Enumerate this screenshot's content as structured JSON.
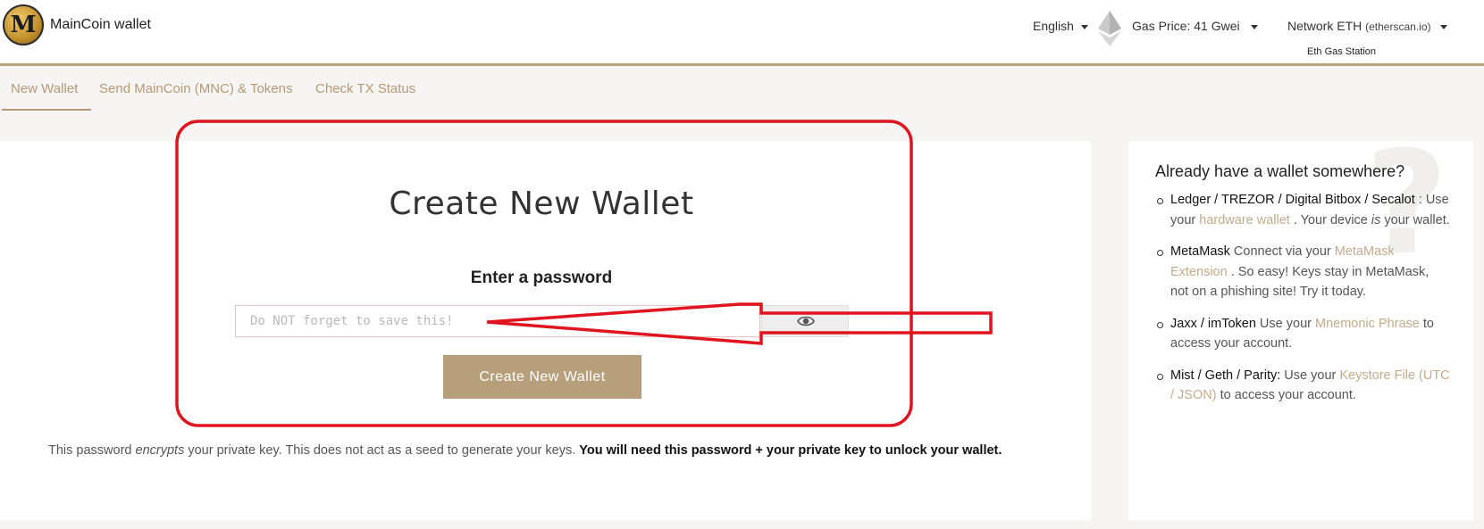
{
  "header": {
    "logo_letter": "M",
    "app_title": "MainCoin wallet",
    "language": "English",
    "gas_price": "Gas Price: 41 Gwei",
    "network_label": "Network ETH",
    "network_source": "(etherscan.io)",
    "gas_station": "Eth Gas Station"
  },
  "nav": {
    "tabs": [
      {
        "label": "New Wallet",
        "active": true
      },
      {
        "label": "Send MainCoin (MNC) & Tokens",
        "active": false
      },
      {
        "label": "Check TX Status",
        "active": false
      }
    ]
  },
  "main": {
    "title": "Create New Wallet",
    "password_heading": "Enter a password",
    "password_placeholder": "Do NOT forget to save this!",
    "password_value": "",
    "toggle_icon": "eye-icon",
    "create_button": "Create New Wallet",
    "note_part1": "This password ",
    "note_em": "encrypts",
    "note_part2": " your private key. This does not act as a seed to generate your keys. ",
    "note_bold": "You will need this password + your private key to unlock your wallet."
  },
  "side": {
    "title": "Already have a wallet somewhere?",
    "items": [
      {
        "name": "Ledger / TREZOR / Digital Bitbox / Secalot",
        "text1": " : Use your ",
        "link": "hardware wallet",
        "text2": " . Your device ",
        "em": "is",
        "text3": " your wallet."
      },
      {
        "name": "MetaMask",
        "text1": " Connect via your ",
        "link": "MetaMask Extension",
        "text2": " . So easy! Keys stay in MetaMask, not on a phishing site! Try it today."
      },
      {
        "name": "Jaxx / imToken",
        "text1": " Use your ",
        "link": "Mnemonic Phrase",
        "text2": " to access your account."
      },
      {
        "name": "Mist / Geth / Parity:",
        "text1": " Use your ",
        "link": "Keystore File (UTC / JSON)",
        "text2": " to access your account."
      }
    ]
  },
  "colors": {
    "accent": "#b89f7c",
    "link": "#c2ab8a",
    "annotation": "#e0141e"
  }
}
